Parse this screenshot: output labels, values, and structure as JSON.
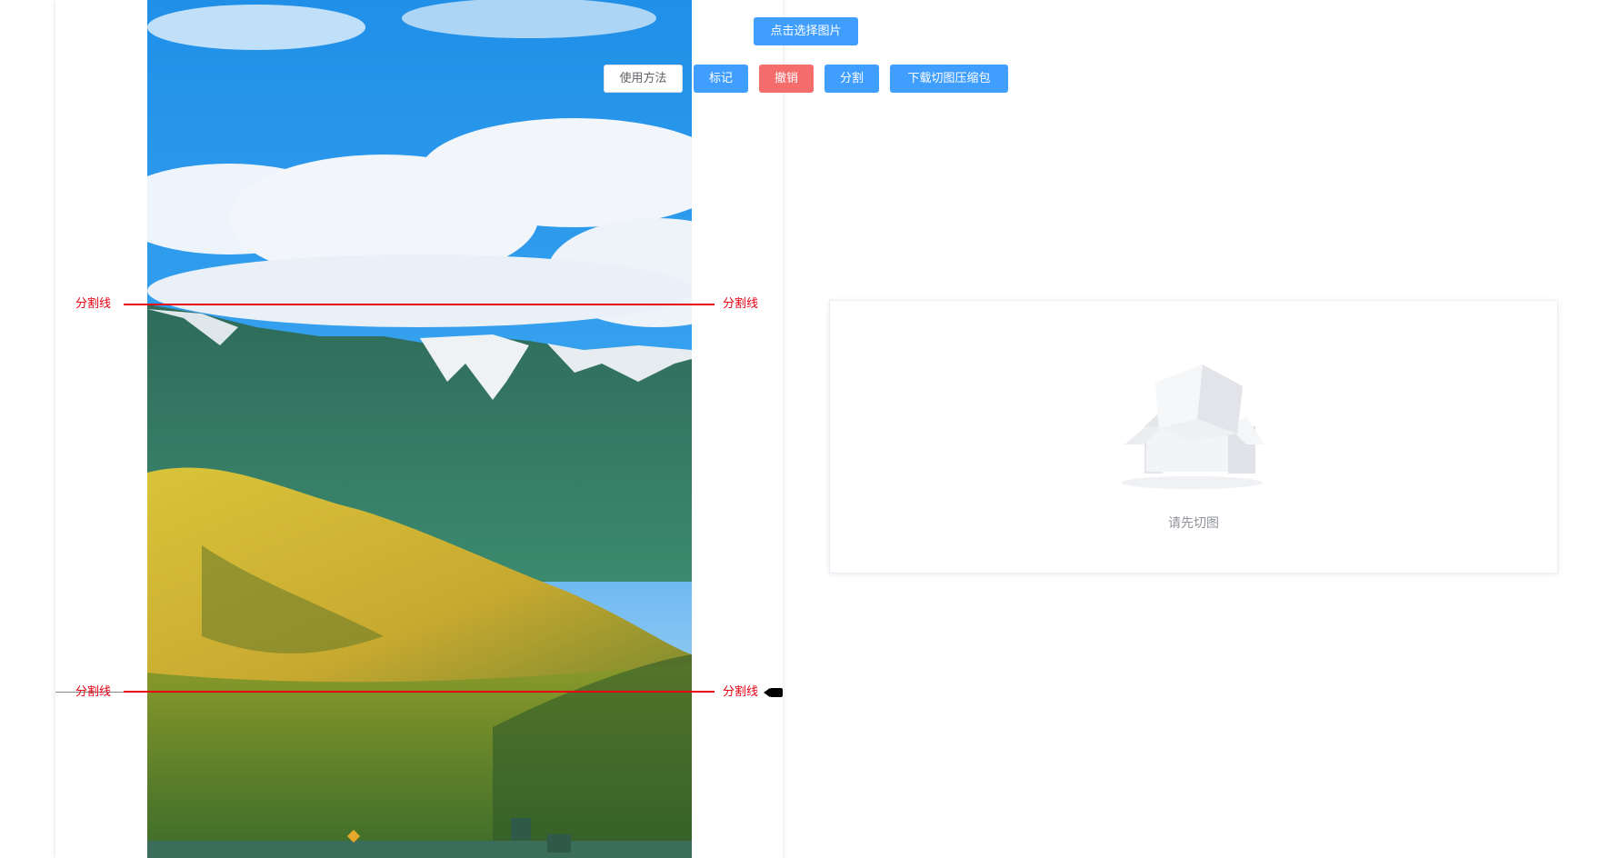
{
  "toolbar": {
    "select_image_label": "点击选择图片",
    "usage_label": "使用方法",
    "mark_label": "标记",
    "undo_label": "撤销",
    "split_label": "分割",
    "download_label": "下载切图压缩包"
  },
  "editor": {
    "split_lines": [
      {
        "left_label": "分割线",
        "right_label": "分割线"
      },
      {
        "left_label": "分割线",
        "right_label": "分割线"
      }
    ]
  },
  "preview": {
    "empty_text": "请先切图"
  },
  "colors": {
    "primary": "#409eff",
    "danger": "#f56c6c",
    "split_line": "#e60012",
    "empty_text": "#909399"
  }
}
